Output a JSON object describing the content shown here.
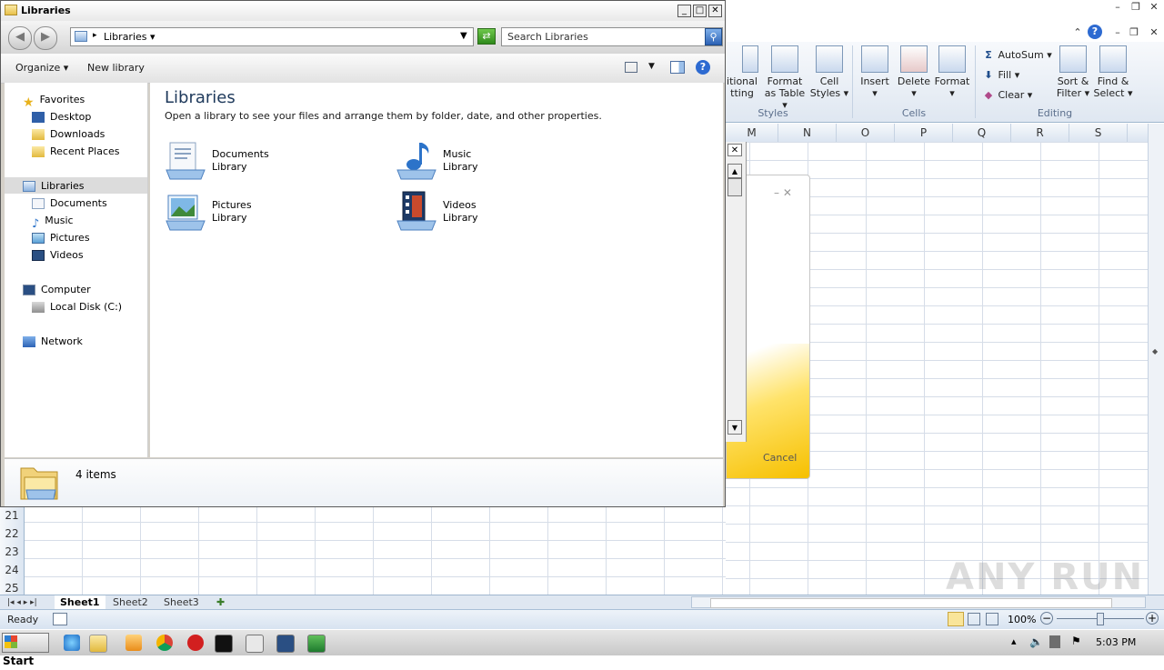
{
  "explorer": {
    "title": "Libraries",
    "address_crumb": "Libraries",
    "search_placeholder": "Search Libraries",
    "toolbar": {
      "organize": "Organize",
      "new_library": "New library"
    },
    "nav": {
      "favorites": "Favorites",
      "desktop": "Desktop",
      "downloads": "Downloads",
      "recent_places": "Recent Places",
      "libraries": "Libraries",
      "documents": "Documents",
      "music": "Music",
      "pictures": "Pictures",
      "videos": "Videos",
      "computer": "Computer",
      "local_disk": "Local Disk (C:)",
      "network": "Network"
    },
    "content": {
      "heading": "Libraries",
      "subtitle": "Open a library to see your files and arrange them by folder, date, and other properties.",
      "libraries": [
        {
          "name": "Documents",
          "type": "Library",
          "icon": "documents-library-icon"
        },
        {
          "name": "Music",
          "type": "Library",
          "icon": "music-library-icon"
        },
        {
          "name": "Pictures",
          "type": "Library",
          "icon": "pictures-library-icon"
        },
        {
          "name": "Videos",
          "type": "Library",
          "icon": "videos-library-icon"
        }
      ]
    },
    "details": {
      "count": "4 items"
    }
  },
  "excel": {
    "ribbon": {
      "styles": {
        "conditional": "itional",
        "conditional2": "tting",
        "format_table_1": "Format",
        "format_table_2": "as Table",
        "cell_styles_1": "Cell",
        "cell_styles_2": "Styles",
        "group": "Styles"
      },
      "cells": {
        "insert": "Insert",
        "delete": "Delete",
        "format": "Format",
        "group": "Cells"
      },
      "editing": {
        "autosum": "AutoSum",
        "fill": "Fill",
        "clear": "Clear",
        "sort_1": "Sort &",
        "sort_2": "Filter",
        "find_1": "Find &",
        "find_2": "Select",
        "group": "Editing"
      }
    },
    "columns": [
      "M",
      "N",
      "O",
      "P",
      "Q",
      "R",
      "S"
    ],
    "rows": [
      "21",
      "22",
      "23",
      "24",
      "25"
    ],
    "sheets": [
      "Sheet1",
      "Sheet2",
      "Sheet3"
    ],
    "status": "Ready",
    "zoom": "100%",
    "dialog": {
      "cancel": "Cancel"
    }
  },
  "taskbar": {
    "start": "Start",
    "clock": "5:03 PM"
  },
  "watermark": "ANY RUN"
}
